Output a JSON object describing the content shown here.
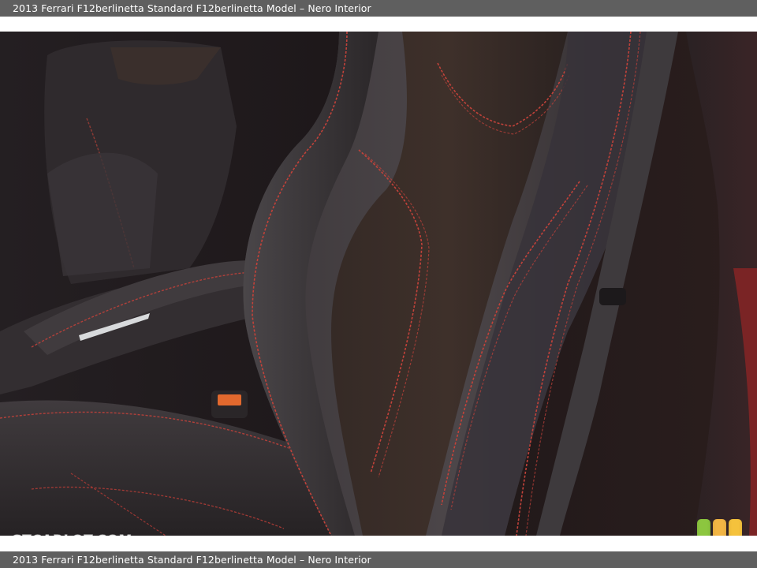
{
  "caption": {
    "top": "2013 Ferrari F12berlinetta Standard F12berlinetta Model – Nero Interior",
    "bottom": "2013 Ferrari F12berlinetta Standard F12berlinetta Model – Nero Interior"
  },
  "watermark": {
    "text": "GTCARLOT.COM"
  },
  "badge": {
    "colors": [
      "#8cc63f",
      "#f2b544",
      "#f5c23c"
    ]
  },
  "photo": {
    "subject": "black leather sports seat with red contrast stitching",
    "colors": {
      "leather": "#2a2527",
      "stitch": "#c2423a",
      "highlight": "#5a5456"
    }
  }
}
